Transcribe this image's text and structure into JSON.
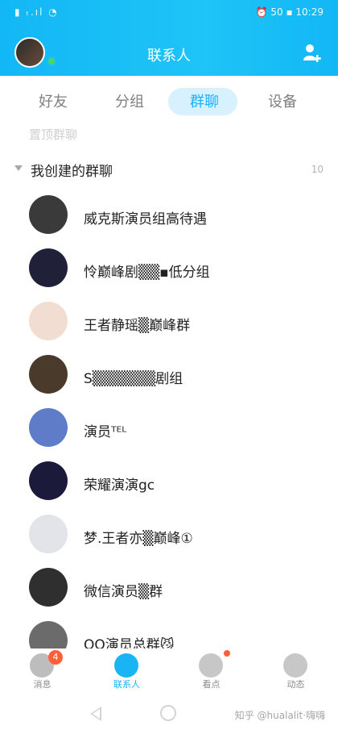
{
  "status_bar": {
    "left": "▮ ₜ.ıl ◔",
    "right": "⏰ 50 ▪ 10:29"
  },
  "header": {
    "title": "联系人",
    "add_icon": "add-user-icon"
  },
  "tabs": [
    {
      "label": "好友",
      "active": false
    },
    {
      "label": "分组",
      "active": false
    },
    {
      "label": "群聊",
      "active": true
    },
    {
      "label": "设备",
      "active": false
    }
  ],
  "partial_header": "置顶群聊",
  "section": {
    "title": "我创建的群聊",
    "count": "10"
  },
  "groups": [
    {
      "name": "威克斯演员组高待遇",
      "color": "#3a3a3a"
    },
    {
      "name": "怜巅峰剧▒▒▪低分组",
      "color": "#202038"
    },
    {
      "name": "王者静瑶▒巅峰群",
      "color": "#f1ddd2"
    },
    {
      "name": "S▒▒▒▒▒▒剧组",
      "color": "#4a3a2c"
    },
    {
      "name": "演员ᵀᴱᴸ",
      "color": "#5e7cc8"
    },
    {
      "name": "荣耀演演gc",
      "color": "#1c1a3a"
    },
    {
      "name": "梦.王者亦▒巅峰①",
      "color": "#e3e3ea"
    },
    {
      "name": "微信演员▒群",
      "color": "#2f2f2f"
    },
    {
      "name": "QQ演员总群😼",
      "color": "#6b6b6b"
    }
  ],
  "bottom_nav": [
    {
      "label": "消息",
      "badge": "4"
    },
    {
      "label": "联系人"
    },
    {
      "label": "看点"
    },
    {
      "label": "动态"
    }
  ],
  "watermark": "知乎 @hualalit·嗨嗨"
}
